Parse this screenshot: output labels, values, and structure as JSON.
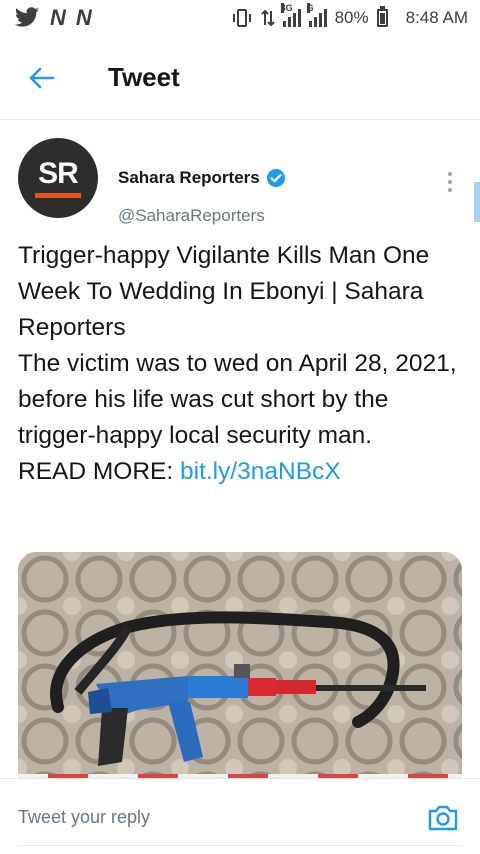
{
  "status_bar": {
    "app_icons": [
      "twitter-icon",
      "N",
      "N"
    ],
    "network_label": "3G",
    "network_label2": "G",
    "battery": "80%",
    "time": "8:48 AM"
  },
  "header": {
    "title": "Tweet"
  },
  "tweet": {
    "author_name": "Sahara Reporters",
    "author_handle": "@SaharaReporters",
    "avatar_text": "SR",
    "text_line1": "Trigger-happy Vigilante Kills Man One Week To Wedding In Ebonyi | Sahara Reporters",
    "text_line2": "The victim was to wed on April 28, 2021, before his life was cut short by the trigger-happy local security man.",
    "read_more_label": "READ MORE: ",
    "link": "bit.ly/3naNBcX"
  },
  "reply": {
    "placeholder": "Tweet your reply"
  },
  "colors": {
    "accent": "#1d9bf0",
    "verified": "#1d9bf0",
    "avatar_bg": "#2d2d2d",
    "avatar_bar": "#e8531f"
  }
}
